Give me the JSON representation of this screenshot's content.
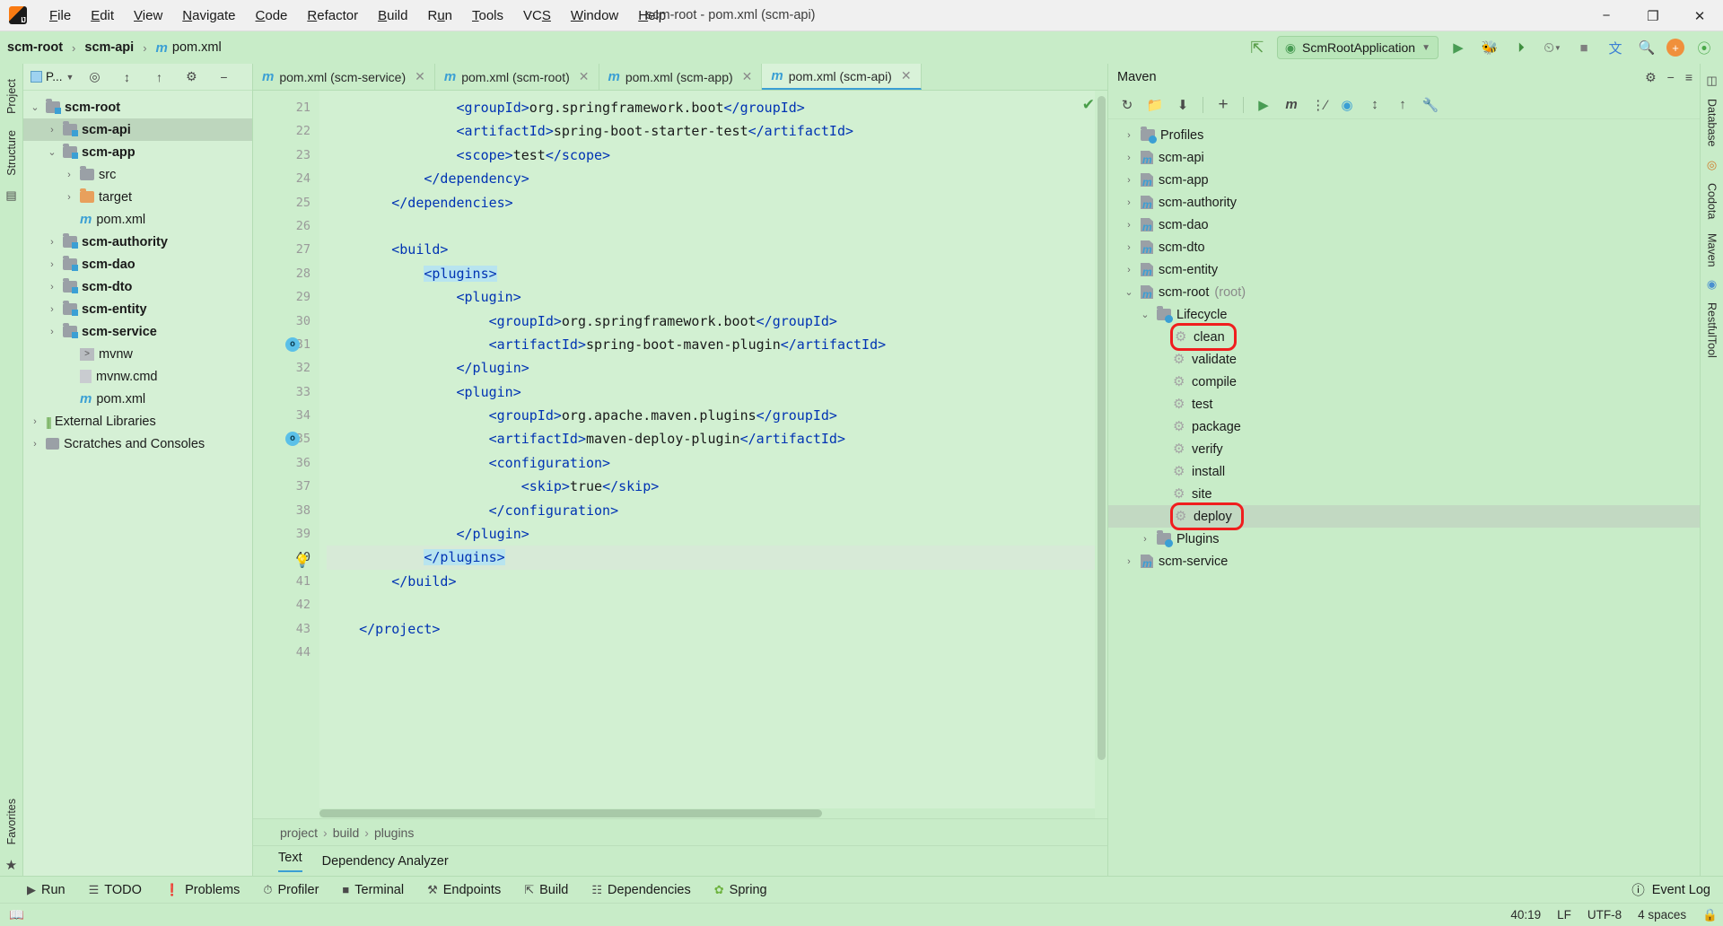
{
  "window": {
    "title": "scm-root - pom.xml (scm-api)",
    "minimize": "−",
    "maximize": "❐",
    "close": "✕"
  },
  "menubar": [
    {
      "label": "File"
    },
    {
      "label": "Edit"
    },
    {
      "label": "View"
    },
    {
      "label": "Navigate"
    },
    {
      "label": "Code"
    },
    {
      "label": "Refactor"
    },
    {
      "label": "Build"
    },
    {
      "label": "Run"
    },
    {
      "label": "Tools"
    },
    {
      "label": "VCS"
    },
    {
      "label": "Window"
    },
    {
      "label": "Help"
    }
  ],
  "navbar": {
    "crumbs": [
      "scm-root",
      "scm-api",
      "pom.xml"
    ],
    "file_icon": "maven-m-icon",
    "run_config": "ScmRootApplication",
    "icons": {
      "build": "hammer-icon",
      "run": "run-icon",
      "debug": "debug-icon",
      "run_coverage": "run-with-coverage-icon",
      "profile": "profiler-dropdown-icon",
      "stop": "stop-icon",
      "translate": "translate-icon",
      "search": "search-icon",
      "updates": "plugin-update-icon",
      "ai": "ai-assistant-icon"
    }
  },
  "left_rail": {
    "items": [
      "Project",
      "Structure",
      "Favorites"
    ]
  },
  "project_panel": {
    "title": "P...",
    "toolbar_icons": [
      "target-icon",
      "collapse-all-icon",
      "expand-all-icon",
      "gear-icon",
      "hide-icon"
    ],
    "tree": [
      {
        "label": "scm-root",
        "indent": 0,
        "arrow": "⌄",
        "icon": "module-folder",
        "bold": true,
        "selected": false
      },
      {
        "label": "scm-api",
        "indent": 1,
        "arrow": "›",
        "icon": "module-folder",
        "bold": true,
        "selected": true
      },
      {
        "label": "scm-app",
        "indent": 1,
        "arrow": "⌄",
        "icon": "module-folder",
        "bold": true,
        "selected": false
      },
      {
        "label": "src",
        "indent": 2,
        "arrow": "›",
        "icon": "folder",
        "bold": false,
        "selected": false
      },
      {
        "label": "target",
        "indent": 2,
        "arrow": "›",
        "icon": "folder-orange",
        "bold": false,
        "selected": false
      },
      {
        "label": "pom.xml",
        "indent": 2,
        "arrow": "",
        "icon": "maven-m-icon",
        "bold": false,
        "selected": false
      },
      {
        "label": "scm-authority",
        "indent": 1,
        "arrow": "›",
        "icon": "module-folder",
        "bold": true,
        "selected": false
      },
      {
        "label": "scm-dao",
        "indent": 1,
        "arrow": "›",
        "icon": "module-folder",
        "bold": true,
        "selected": false
      },
      {
        "label": "scm-dto",
        "indent": 1,
        "arrow": "›",
        "icon": "module-folder",
        "bold": true,
        "selected": false
      },
      {
        "label": "scm-entity",
        "indent": 1,
        "arrow": "›",
        "icon": "module-folder",
        "bold": true,
        "selected": false
      },
      {
        "label": "scm-service",
        "indent": 1,
        "arrow": "›",
        "icon": "module-folder",
        "bold": true,
        "selected": false
      },
      {
        "label": "mvnw",
        "indent": 2,
        "arrow": "",
        "icon": "script-icon",
        "bold": false,
        "selected": false
      },
      {
        "label": "mvnw.cmd",
        "indent": 2,
        "arrow": "",
        "icon": "cmd-file-icon",
        "bold": false,
        "selected": false
      },
      {
        "label": "pom.xml",
        "indent": 2,
        "arrow": "",
        "icon": "maven-m-icon",
        "bold": false,
        "selected": false
      },
      {
        "label": "External Libraries",
        "indent": 0,
        "arrow": "›",
        "icon": "libraries-icon",
        "bold": false,
        "selected": false
      },
      {
        "label": "Scratches and Consoles",
        "indent": 0,
        "arrow": "›",
        "icon": "scratches-icon",
        "bold": false,
        "selected": false
      }
    ]
  },
  "editor": {
    "tabs": [
      {
        "label": "pom.xml (scm-service)",
        "active": false
      },
      {
        "label": "pom.xml (scm-root)",
        "active": false
      },
      {
        "label": "pom.xml (scm-app)",
        "active": false
      },
      {
        "label": "pom.xml (scm-api)",
        "active": true
      }
    ],
    "first_line_number": 21,
    "lines": [
      {
        "n": 21,
        "indent": 8,
        "parts": [
          {
            "t": "tag",
            "v": "<groupId>"
          },
          {
            "t": "txt",
            "v": "org.springframework.boot"
          },
          {
            "t": "tag",
            "v": "</groupId>"
          }
        ]
      },
      {
        "n": 22,
        "indent": 8,
        "parts": [
          {
            "t": "tag",
            "v": "<artifactId>"
          },
          {
            "t": "txt",
            "v": "spring-boot-starter-test"
          },
          {
            "t": "tag",
            "v": "</artifactId>"
          }
        ]
      },
      {
        "n": 23,
        "indent": 8,
        "parts": [
          {
            "t": "tag",
            "v": "<scope>"
          },
          {
            "t": "txt",
            "v": "test"
          },
          {
            "t": "tag",
            "v": "</scope>"
          }
        ]
      },
      {
        "n": 24,
        "indent": 6,
        "parts": [
          {
            "t": "tag",
            "v": "</dependency>"
          }
        ]
      },
      {
        "n": 25,
        "indent": 4,
        "parts": [
          {
            "t": "tag",
            "v": "</dependencies>"
          }
        ]
      },
      {
        "n": 26,
        "indent": 0,
        "parts": []
      },
      {
        "n": 27,
        "indent": 4,
        "parts": [
          {
            "t": "tag",
            "v": "<build>"
          }
        ]
      },
      {
        "n": 28,
        "indent": 6,
        "parts": [
          {
            "t": "tag-hl",
            "v": "<plugins>"
          }
        ]
      },
      {
        "n": 29,
        "indent": 8,
        "parts": [
          {
            "t": "tag",
            "v": "<plugin>"
          }
        ]
      },
      {
        "n": 30,
        "indent": 10,
        "parts": [
          {
            "t": "tag",
            "v": "<groupId>"
          },
          {
            "t": "txt",
            "v": "org.springframework.boot"
          },
          {
            "t": "tag",
            "v": "</groupId>"
          }
        ]
      },
      {
        "n": 31,
        "indent": 10,
        "parts": [
          {
            "t": "tag",
            "v": "<artifactId>"
          },
          {
            "t": "txt",
            "v": "spring-boot-maven-plugin"
          },
          {
            "t": "tag",
            "v": "</artifactId>"
          }
        ],
        "mark": "o"
      },
      {
        "n": 32,
        "indent": 8,
        "parts": [
          {
            "t": "tag",
            "v": "</plugin>"
          }
        ]
      },
      {
        "n": 33,
        "indent": 8,
        "parts": [
          {
            "t": "tag",
            "v": "<plugin>"
          }
        ]
      },
      {
        "n": 34,
        "indent": 10,
        "parts": [
          {
            "t": "tag",
            "v": "<groupId>"
          },
          {
            "t": "txt",
            "v": "org.apache.maven.plugins"
          },
          {
            "t": "tag",
            "v": "</groupId>"
          }
        ]
      },
      {
        "n": 35,
        "indent": 10,
        "parts": [
          {
            "t": "tag",
            "v": "<artifactId>"
          },
          {
            "t": "txt",
            "v": "maven-deploy-plugin"
          },
          {
            "t": "tag",
            "v": "</artifactId>"
          }
        ],
        "mark": "o"
      },
      {
        "n": 36,
        "indent": 10,
        "parts": [
          {
            "t": "tag",
            "v": "<configuration>"
          }
        ]
      },
      {
        "n": 37,
        "indent": 12,
        "parts": [
          {
            "t": "tag",
            "v": "<skip>"
          },
          {
            "t": "txt",
            "v": "true"
          },
          {
            "t": "tag",
            "v": "</skip>"
          }
        ]
      },
      {
        "n": 38,
        "indent": 10,
        "parts": [
          {
            "t": "tag",
            "v": "</configuration>"
          }
        ]
      },
      {
        "n": 39,
        "indent": 8,
        "parts": [
          {
            "t": "tag",
            "v": "</plugin>"
          }
        ]
      },
      {
        "n": 40,
        "indent": 6,
        "parts": [
          {
            "t": "tag-hl",
            "v": "</plugins>"
          }
        ],
        "current": true,
        "bulb": true
      },
      {
        "n": 41,
        "indent": 4,
        "parts": [
          {
            "t": "tag",
            "v": "</build>"
          }
        ]
      },
      {
        "n": 42,
        "indent": 0,
        "parts": []
      },
      {
        "n": 43,
        "indent": 2,
        "parts": [
          {
            "t": "tag",
            "v": "</project>"
          }
        ]
      },
      {
        "n": 44,
        "indent": 0,
        "parts": []
      }
    ],
    "breadcrumbs": [
      "project",
      "build",
      "plugins"
    ],
    "bottom_tabs": [
      {
        "label": "Text",
        "active": true
      },
      {
        "label": "Dependency Analyzer",
        "active": false
      }
    ],
    "inspection_status": "ok-check-icon"
  },
  "maven": {
    "title": "Maven",
    "header_icons": [
      "gear-icon",
      "hide-icon",
      "more-icon"
    ],
    "toolbar_icons": [
      "reload-icon",
      "add-maven-projects-icon",
      "download-sources-icon",
      "add-icon",
      "run-icon",
      "execute-maven-goal-icon",
      "toggle-skip-tests-icon",
      "toggle-offline-icon",
      "expand-all-icon",
      "collapse-all-icon",
      "maven-settings-icon"
    ],
    "tree": [
      {
        "label": "Profiles",
        "indent": 0,
        "arrow": "›",
        "icon": "profiles-folder",
        "highlight": "none",
        "selected": false
      },
      {
        "label": "scm-api",
        "indent": 0,
        "arrow": "›",
        "icon": "maven-module",
        "highlight": "none",
        "selected": false
      },
      {
        "label": "scm-app",
        "indent": 0,
        "arrow": "›",
        "icon": "maven-module",
        "highlight": "none",
        "selected": false
      },
      {
        "label": "scm-authority",
        "indent": 0,
        "arrow": "›",
        "icon": "maven-module",
        "highlight": "none",
        "selected": false
      },
      {
        "label": "scm-dao",
        "indent": 0,
        "arrow": "›",
        "icon": "maven-module",
        "highlight": "none",
        "selected": false
      },
      {
        "label": "scm-dto",
        "indent": 0,
        "arrow": "›",
        "icon": "maven-module",
        "highlight": "none",
        "selected": false
      },
      {
        "label": "scm-entity",
        "indent": 0,
        "arrow": "›",
        "icon": "maven-module",
        "highlight": "none",
        "selected": false
      },
      {
        "label": "scm-root",
        "suffix": " (root)",
        "indent": 0,
        "arrow": "⌄",
        "icon": "maven-module",
        "highlight": "none",
        "selected": false
      },
      {
        "label": "Lifecycle",
        "indent": 1,
        "arrow": "⌄",
        "icon": "lifecycle-folder",
        "highlight": "none",
        "selected": false
      },
      {
        "label": "clean",
        "indent": 2,
        "arrow": "",
        "icon": "goal-gear",
        "highlight": "red",
        "selected": false
      },
      {
        "label": "validate",
        "indent": 2,
        "arrow": "",
        "icon": "goal-gear",
        "highlight": "none",
        "selected": false
      },
      {
        "label": "compile",
        "indent": 2,
        "arrow": "",
        "icon": "goal-gear",
        "highlight": "none",
        "selected": false
      },
      {
        "label": "test",
        "indent": 2,
        "arrow": "",
        "icon": "goal-gear",
        "highlight": "none",
        "selected": false
      },
      {
        "label": "package",
        "indent": 2,
        "arrow": "",
        "icon": "goal-gear",
        "highlight": "none",
        "selected": false
      },
      {
        "label": "verify",
        "indent": 2,
        "arrow": "",
        "icon": "goal-gear",
        "highlight": "none",
        "selected": false
      },
      {
        "label": "install",
        "indent": 2,
        "arrow": "",
        "icon": "goal-gear",
        "highlight": "none",
        "selected": false
      },
      {
        "label": "site",
        "indent": 2,
        "arrow": "",
        "icon": "goal-gear",
        "highlight": "none",
        "selected": false
      },
      {
        "label": "deploy",
        "indent": 2,
        "arrow": "",
        "icon": "goal-gear",
        "highlight": "red",
        "selected": true
      },
      {
        "label": "Plugins",
        "indent": 1,
        "arrow": "›",
        "icon": "plugins-folder",
        "highlight": "none",
        "selected": false
      },
      {
        "label": "scm-service",
        "indent": 0,
        "arrow": "›",
        "icon": "maven-module",
        "highlight": "none",
        "selected": false
      }
    ]
  },
  "right_rail": {
    "items": [
      "Database",
      "Codota",
      "Maven",
      "RestfulTool"
    ]
  },
  "bottom_bar": {
    "items": [
      {
        "label": "Run",
        "icon": "run-icon"
      },
      {
        "label": "TODO",
        "icon": "todo-icon"
      },
      {
        "label": "Problems",
        "icon": "problems-icon"
      },
      {
        "label": "Profiler",
        "icon": "profiler-icon"
      },
      {
        "label": "Terminal",
        "icon": "terminal-icon"
      },
      {
        "label": "Endpoints",
        "icon": "endpoints-icon"
      },
      {
        "label": "Build",
        "icon": "build-hammer-icon"
      },
      {
        "label": "Dependencies",
        "icon": "dependencies-icon"
      },
      {
        "label": "Spring",
        "icon": "spring-leaf-icon"
      }
    ],
    "event_log": "Event Log"
  },
  "statusbar": {
    "caret": "40:19",
    "line_separator": "LF",
    "encoding": "UTF-8",
    "indent": "4 spaces",
    "left_icon": "status-book-icon",
    "lock_icon": "lock-icon"
  },
  "colors": {
    "accent": "#3b9fd4",
    "highlight_red": "#f01e1e",
    "background": "#c8ecc8",
    "editor_bg": "#d2f0d2",
    "xml_tag": "#0033b3"
  }
}
